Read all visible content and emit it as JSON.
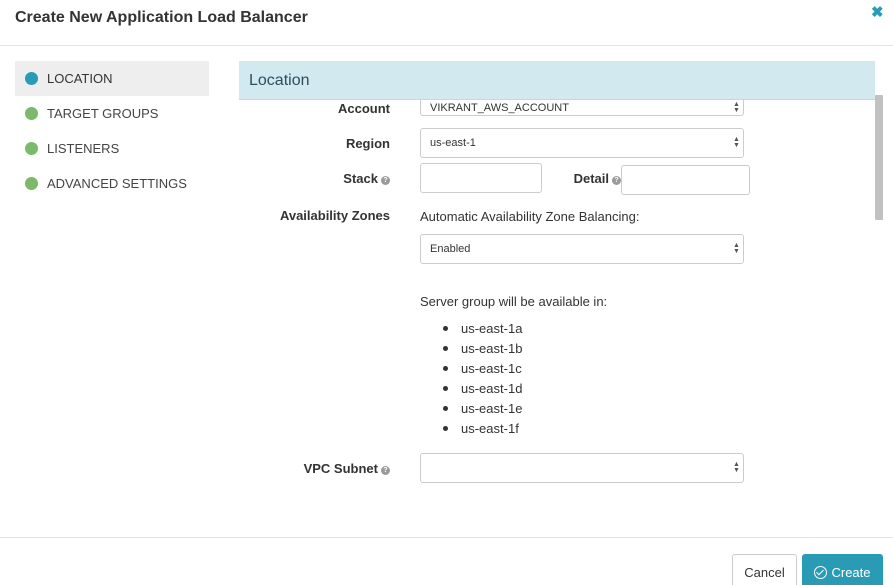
{
  "dialog": {
    "title": "Create New Application Load Balancer",
    "close_icon": "✖"
  },
  "nav": {
    "items": [
      {
        "label": "LOCATION",
        "active": true,
        "dot_color": "#2a9bb5"
      },
      {
        "label": "TARGET GROUPS",
        "active": false,
        "dot_color": "#7cb96a"
      },
      {
        "label": "LISTENERS",
        "active": false,
        "dot_color": "#7cb96a"
      },
      {
        "label": "ADVANCED SETTINGS",
        "active": false,
        "dot_color": "#7cb96a"
      }
    ]
  },
  "section": {
    "title": "Location"
  },
  "form": {
    "account_label": "Account",
    "account_value": "VIKRANT_AWS_ACCOUNT",
    "region_label": "Region",
    "region_value": "us-east-1",
    "stack_label": "Stack",
    "stack_value": "",
    "detail_label": "Detail",
    "detail_value": "",
    "availability_label": "Availability Zones",
    "auto_balancing_label": "Automatic Availability Zone Balancing:",
    "auto_balancing_value": "Enabled",
    "server_group_text": "Server group will be available in:",
    "zones": [
      "us-east-1a",
      "us-east-1b",
      "us-east-1c",
      "us-east-1d",
      "us-east-1e",
      "us-east-1f"
    ],
    "vpc_label": "VPC Subnet",
    "vpc_value": "",
    "help_glyph": "?"
  },
  "footer": {
    "cancel_label": "Cancel",
    "create_label": "Create"
  },
  "colors": {
    "accent": "#2a9bb5",
    "complete": "#7cb96a",
    "section_bg": "#d2e9ef"
  }
}
